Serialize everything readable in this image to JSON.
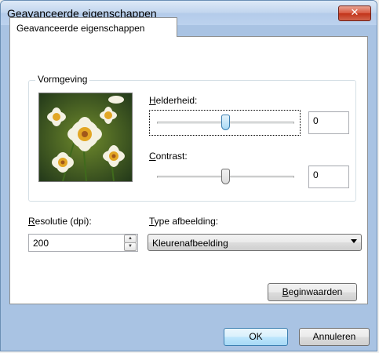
{
  "window": {
    "title": "Geavanceerde eigenschappen",
    "close_symbol": "✕"
  },
  "tabs": [
    {
      "label": "Geavanceerde eigenschappen",
      "selected": true
    }
  ],
  "appearance_group": {
    "label": "Vormgeving",
    "preview_image": "daisy-flowers-photo",
    "brightness": {
      "mnemonic": "H",
      "label_rest": "elderheid:",
      "value": "0",
      "slider_level": 0.5
    },
    "contrast": {
      "mnemonic": "C",
      "label_rest": "ontrast:",
      "value": "0",
      "slider_level": 0.5
    }
  },
  "resolution": {
    "mnemonic": "R",
    "label_rest": "esolutie (dpi):",
    "value": "200",
    "up_symbol": "▲",
    "down_symbol": "▼"
  },
  "image_type": {
    "mnemonic": "T",
    "label_rest": "ype afbeelding:",
    "selected": "Kleurenafbeelding"
  },
  "buttons": {
    "reset_mnemonic": "B",
    "reset_rest": "eginwaarden",
    "ok": "OK",
    "cancel": "Annuleren"
  },
  "colors": {
    "title_bar": "#c1d5ee",
    "close_button": "#c13218",
    "active_thumb": "#a7d9f5"
  }
}
